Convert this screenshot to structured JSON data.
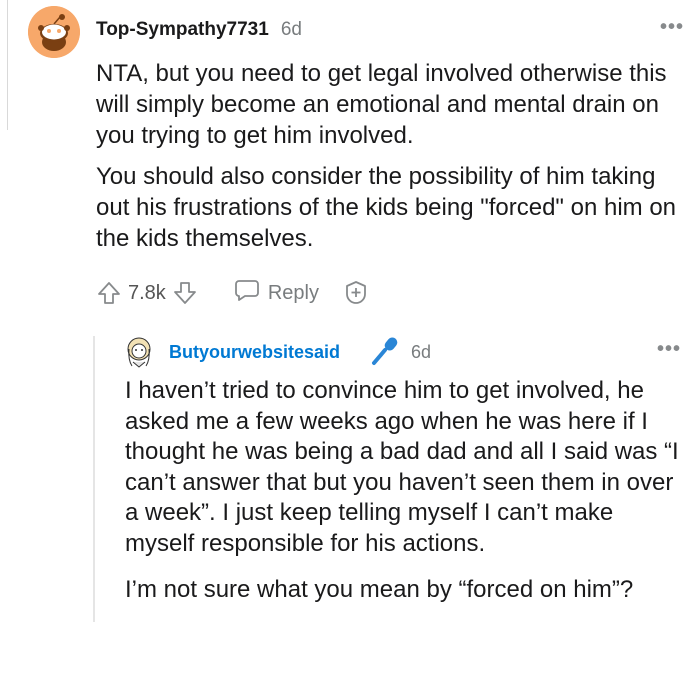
{
  "comment": {
    "username": "Top-Sympathy7731",
    "time": "6d",
    "more_label": "•••",
    "paragraphs": [
      "NTA, but you need to get legal involved otherwise this will simply become an emotional and mental drain on you trying to get him involved.",
      "You should also consider the possibility of him taking out his frustrations of the kids being \"forced\" on him on the kids themselves."
    ],
    "score": "7.8k",
    "reply_label": "Reply",
    "icons": [
      "upvote-icon",
      "downvote-icon",
      "reply-bubble-icon",
      "award-icon",
      "snoo-avatar-icon"
    ]
  },
  "reply": {
    "username": "Butyourwebsitesaid",
    "time": "6d",
    "more_label": "•••",
    "paragraphs": [
      "I haven’t tried to convince him to get involved, he asked me a few weeks ago when he was here if I thought he was being a bad dad and all I said was “I can’t answer that but you haven’t seen them in over a week”. I just keep telling myself I can’t make myself responsible for his actions.",
      "I’m not sure what you mean by “forced on him”?"
    ],
    "icons": [
      "user-avatar-icon",
      "microphone-icon"
    ]
  },
  "colors": {
    "username_blue": "#0079d3",
    "text": "#1a1a1b",
    "meta_gray": "#787c7e",
    "avatar_orange": "#f7a86a"
  }
}
